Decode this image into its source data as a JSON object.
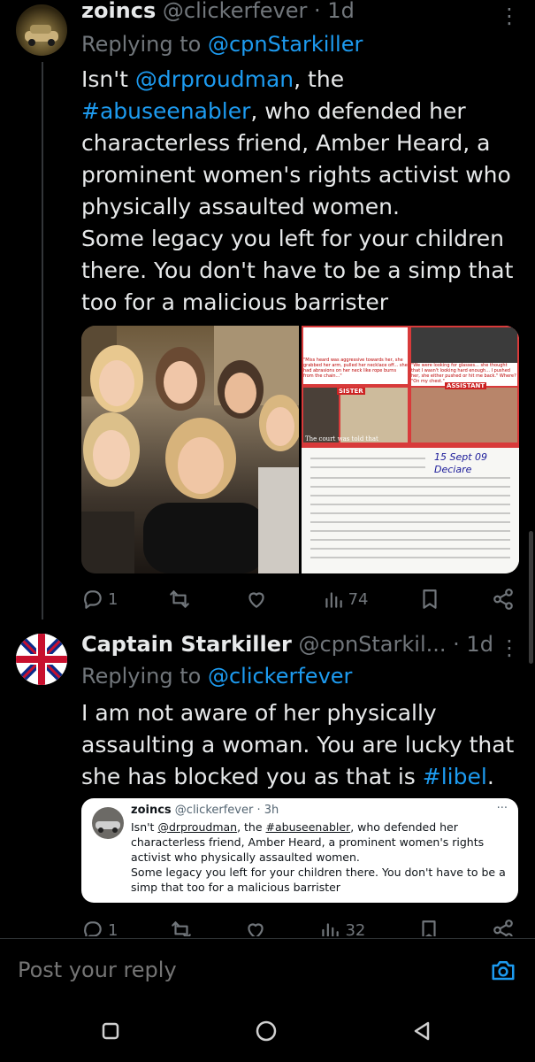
{
  "tweet1": {
    "display_name": "zoincs",
    "handle": "@clickerfever",
    "separator": "·",
    "time": "1d",
    "replying_label": "Replying to",
    "replying_handle": "@cpnStarkiller",
    "body": {
      "p1_a": "Isn't ",
      "p1_mention": "@drproudman",
      "p1_b": ", the ",
      "p1_hashtag": "#abuseenabler",
      "p1_c": ", who defended her characterless friend, Amber Heard, a prominent women's rights activist who physically assaulted women.",
      "p2": "Some legacy you left for your children there. You don't have to be a simp that too for a malicious barrister"
    },
    "media": {
      "collage_texts": {
        "quote_a": "\"Miss heard was aggressive towards her, she grabbed her arm, pulled her necklace off... she had abrasions on her neck like rope burns from the chain...\"",
        "quote_b": "\"We were looking for glasses... she thought that I wasn't looking hard enough... I pushed her, she either pushed or hit me back.\" Where? \"On my chest.\"",
        "label_sister": "SISTER",
        "label_assistant": "ASSISTANT",
        "caption": "The court was told that",
        "doc_date": "15 Sept 09",
        "doc_name": "Deciare"
      }
    },
    "stats": {
      "replies": "1",
      "retweets": "",
      "likes": "",
      "views": "74"
    }
  },
  "tweet2": {
    "display_name": "Captain Starkiller",
    "handle": "@cpnStarkil...",
    "separator": "·",
    "time": "1d",
    "replying_label": "Replying to",
    "replying_handle": "@clickerfever",
    "body": {
      "text_a": "I am not aware of her physically assaulting a woman. You are lucky that she has blocked you as that is ",
      "hashtag": "#libel",
      "text_b": "."
    },
    "quote": {
      "display_name": "zoincs",
      "handle": "@clickerfever",
      "separator": "·",
      "time": "3h",
      "text_a": "Isn't ",
      "mention": "@drproudman",
      "text_b": ", the ",
      "hashtag": "#abuseenabler",
      "text_c": ", who defended her characterless friend, Amber Heard, a prominent women's rights activist who physically assaulted women.",
      "text_p2": "Some legacy you left for your children there. You don't have to be a simp that too for a malicious barrister",
      "more": "···"
    },
    "stats": {
      "replies": "1",
      "views": "32"
    }
  },
  "composer": {
    "placeholder": "Post your reply"
  },
  "colors": {
    "accent": "#1d9bf0",
    "muted": "#71767b",
    "text": "#e7e9ea",
    "background": "#000000"
  },
  "icons": [
    "reply-icon",
    "retweet-icon",
    "like-icon",
    "views-icon",
    "bookmark-icon",
    "share-icon",
    "camera-icon",
    "more-icon",
    "nav-recents-icon",
    "nav-home-icon",
    "nav-back-icon"
  ]
}
